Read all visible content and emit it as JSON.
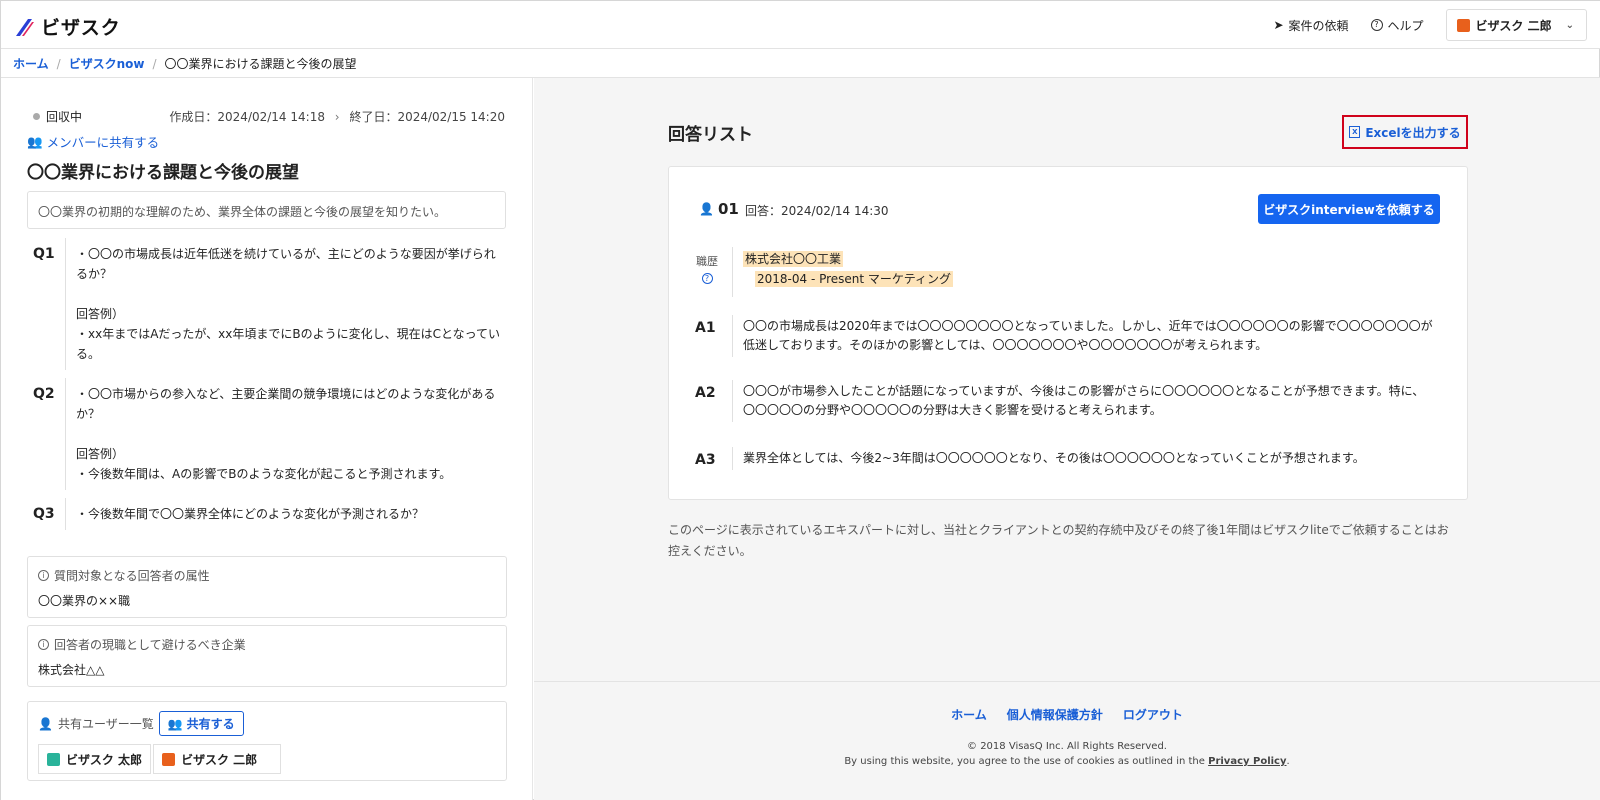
{
  "header": {
    "logo_text": "ビザスク",
    "nav": {
      "request_label": "案件の依頼",
      "help_label": "ヘルプ"
    },
    "user": {
      "name": "ビザスク 二郎"
    }
  },
  "breadcrumb": [
    "ホーム",
    "ビザスクnow",
    "〇〇業界における課題と今後の展望"
  ],
  "left": {
    "status": "回収中",
    "created": "作成日：2024/02/14 14:18",
    "ended": "終了日：2024/02/15 14:20",
    "share_link": "メンバーに共有する",
    "title": "〇〇業界における課題と今後の展望",
    "description": "〇〇業界の初期的な理解のため、業界全体の課題と今後の展望を知りたい。",
    "questions": [
      {
        "label": "Q1",
        "text": "・〇〇の市場成長は近年低迷を続けているが、主にどのような要因が挙げられるか？\n\n回答例）\n・xx年まではAだったが、xx年頃までにBのように変化し、現在はCとなっている。"
      },
      {
        "label": "Q2",
        "text": "・〇〇市場からの参入など、主要企業間の競争環境にはどのような変化があるか？\n\n回答例）\n・今後数年間は、Aの影響でBのような変化が起こると予測されます。"
      },
      {
        "label": "Q3",
        "text": "・今後数年間で〇〇業界全体にどのような変化が予測されるか？"
      }
    ],
    "target_title": "質問対象となる回答者の属性",
    "target_value": "〇〇業界の××職",
    "avoid_title": "回答者の現職として避けるべき企業",
    "avoid_value": "株式会社△△",
    "shared_title": "共有ユーザー一覧",
    "share_button": "共有する",
    "shared_users": [
      "ビザスク 太郎",
      "ビザスク 二郎"
    ]
  },
  "right": {
    "title": "回答リスト",
    "excel_button": "Excelを出力する",
    "answer": {
      "number": "01",
      "date": "回答：2024/02/14 14:30",
      "request_button": "ビザスクinterviewを依頼する",
      "career_label": "職歴",
      "company": "株式会社〇〇工業",
      "position": "2018-04 - Present マーケティング",
      "answers": [
        {
          "label": "A1",
          "text": "〇〇の市場成長は2020年までは〇〇〇〇〇〇〇〇となっていました。しかし、近年では〇〇〇〇〇〇の影響で〇〇〇〇〇〇〇が低迷しております。そのほかの影響としては、〇〇〇〇〇〇〇や〇〇〇〇〇〇〇が考えられます。"
        },
        {
          "label": "A2",
          "text": "〇〇〇が市場参入したことが話題になっていますが、今後はこの影響がさらに〇〇〇〇〇〇となることが予想できます。特に、〇〇〇〇〇の分野や〇〇〇〇〇の分野は大きく影響を受けると考えられます。"
        },
        {
          "label": "A3",
          "text": "業界全体としては、今後2~3年間は〇〇〇〇〇〇となり、その後は〇〇〇〇〇〇となっていくことが予想されます。"
        }
      ]
    },
    "notice": "このページに表示されているエキスパートに対し、当社とクライアントとの契約存続中及びその終了後1年間はビザスクliteでご依頼することはお控えください。"
  },
  "footer": {
    "links": [
      "ホーム",
      "個人情報保護方針",
      "ログアウト"
    ],
    "copyright": "© 2018 VisasQ Inc. All Rights Reserved.",
    "cookie_text": "By using this website, you agree to the use of cookies as outlined in the",
    "privacy_link": "Privacy Policy"
  }
}
